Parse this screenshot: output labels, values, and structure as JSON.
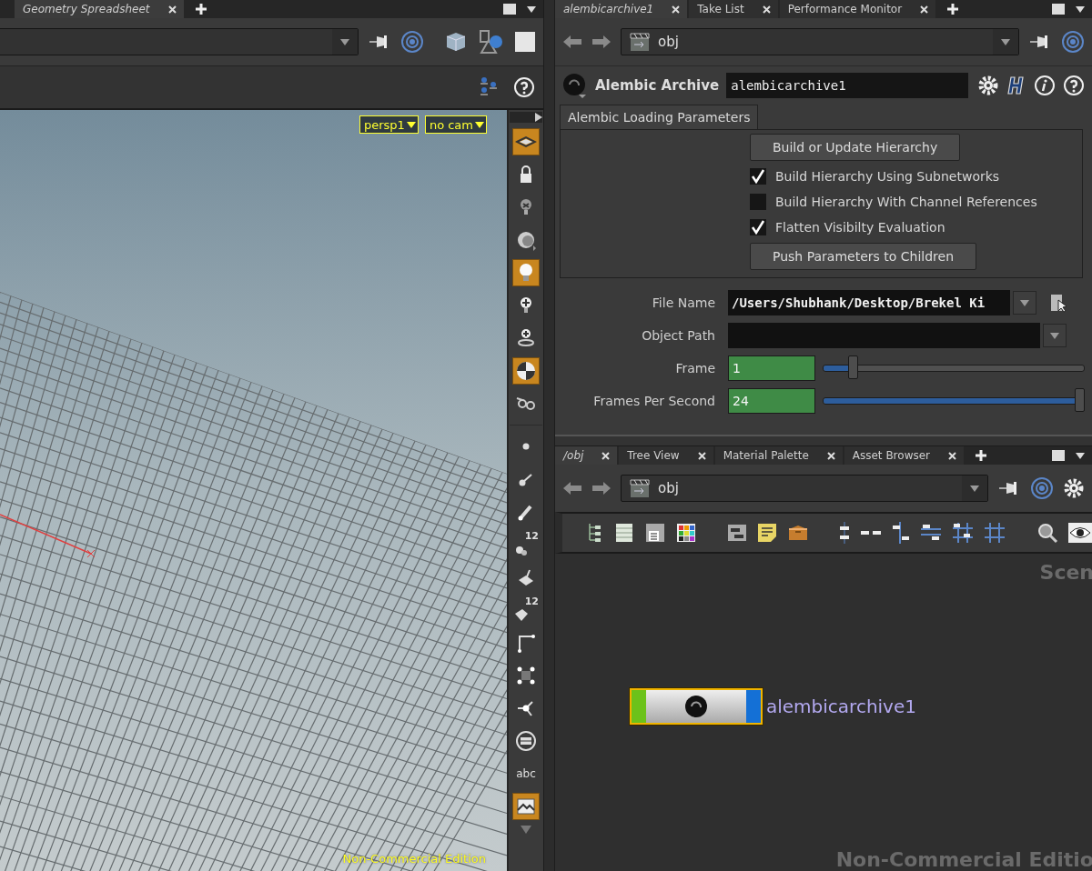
{
  "viewer_pane": {
    "tabs": [
      {
        "label": "Geometry Spreadsheet",
        "selected": true
      }
    ],
    "camera_menus": [
      {
        "label": "persp1"
      },
      {
        "label": "no cam"
      }
    ],
    "edition_label": "Non-Commercial Edition",
    "tools": [
      {
        "kind": "plane",
        "on": true
      },
      {
        "kind": "lock",
        "on": false
      },
      {
        "kind": "ghost",
        "on": false
      },
      {
        "kind": "dome",
        "on": false
      },
      {
        "kind": "light",
        "on": true
      },
      {
        "kind": "addlight",
        "on": false
      },
      {
        "kind": "spotlight",
        "on": false
      },
      {
        "kind": "ball",
        "on": true
      },
      {
        "kind": "glasses",
        "on": false
      },
      {
        "kind": "points",
        "on": false
      },
      {
        "kind": "normals",
        "on": false
      },
      {
        "kind": "vectors",
        "on": false
      },
      {
        "kind": "pointnums",
        "on": false,
        "label": "12"
      },
      {
        "kind": "prims",
        "on": false
      },
      {
        "kind": "primnums",
        "on": false,
        "label": "12"
      },
      {
        "kind": "corner",
        "on": false
      },
      {
        "kind": "boxpts",
        "on": false
      },
      {
        "kind": "node",
        "on": false
      },
      {
        "kind": "ring",
        "on": false
      },
      {
        "kind": "text",
        "on": false,
        "label": "abc"
      },
      {
        "kind": "snapshot",
        "on": true
      }
    ]
  },
  "parameter_pane": {
    "tabs": [
      {
        "label": "alembicarchive1",
        "selected": true
      },
      {
        "label": "Take List",
        "selected": false
      },
      {
        "label": "Performance Monitor",
        "selected": false
      }
    ],
    "path": "obj",
    "node_type": "Alembic Archive",
    "node_name": "alembicarchive1",
    "folder_tab": "Alembic Loading Parameters",
    "folder_items": [
      {
        "kind": "button",
        "label": "Build or Update Hierarchy"
      },
      {
        "kind": "checkbox",
        "label": "Build Hierarchy Using Subnetworks",
        "checked": true
      },
      {
        "kind": "checkbox",
        "label": "Build Hierarchy With Channel References",
        "checked": false
      },
      {
        "kind": "checkbox",
        "label": "Flatten Visibilty Evaluation",
        "checked": true
      },
      {
        "kind": "button",
        "label": "Push Parameters to Children"
      }
    ],
    "parameters": [
      {
        "kind": "file",
        "label": "File Name",
        "value": "/Users/Shubhank/Desktop/Brekel Ki"
      },
      {
        "kind": "menu",
        "label": "Object Path"
      },
      {
        "kind": "slider",
        "label": "Frame",
        "value": "1",
        "level": 0.1
      },
      {
        "kind": "slider",
        "label": "Frames Per Second",
        "value": "24",
        "level": 1
      }
    ]
  },
  "network_pane": {
    "tabs": [
      {
        "label": "/obj",
        "selected": true
      },
      {
        "label": "Tree View",
        "selected": false
      },
      {
        "label": "Material Palette",
        "selected": false
      },
      {
        "label": "Asset Browser",
        "selected": false
      }
    ],
    "path": "obj",
    "network_label": "Scen",
    "node": {
      "name": "alembicarchive1",
      "selected": true
    },
    "edition_label": "Non-Commercial Editio"
  }
}
